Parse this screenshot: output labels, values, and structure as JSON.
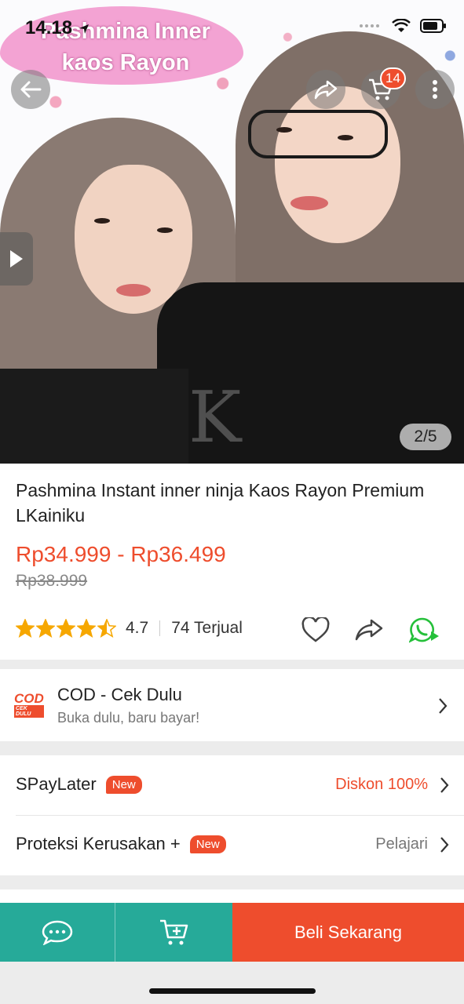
{
  "status_bar": {
    "time": "14.18"
  },
  "hero": {
    "banner_line1": "Pashmina Inner",
    "banner_line2": "kaos Rayon",
    "cart_badge": "14",
    "image_counter": "2/5"
  },
  "product": {
    "title": "Pashmina Instant inner ninja Kaos Rayon Premium LKainiku",
    "price_range": "Rp34.999 - Rp36.499",
    "original_price": "Rp38.999",
    "rating": "4.7",
    "sold": "74 Terjual",
    "stars": 4.5
  },
  "cod": {
    "logo_main": "COD",
    "logo_sub": "CEK DULU",
    "title": "COD - Cek Dulu",
    "subtitle": "Buka dulu, baru bayar!"
  },
  "options": [
    {
      "label": "SPayLater",
      "tag": "New",
      "value": "Diskon 100%"
    },
    {
      "label": "Proteksi Kerusakan +",
      "tag": "New",
      "value": "Pelajari"
    }
  ],
  "bottom_bar": {
    "buy_label": "Beli Sekarang"
  },
  "colors": {
    "accent": "#ee4d2d",
    "teal": "#26aa99",
    "star": "#f6a700",
    "whatsapp": "#25c03a"
  }
}
